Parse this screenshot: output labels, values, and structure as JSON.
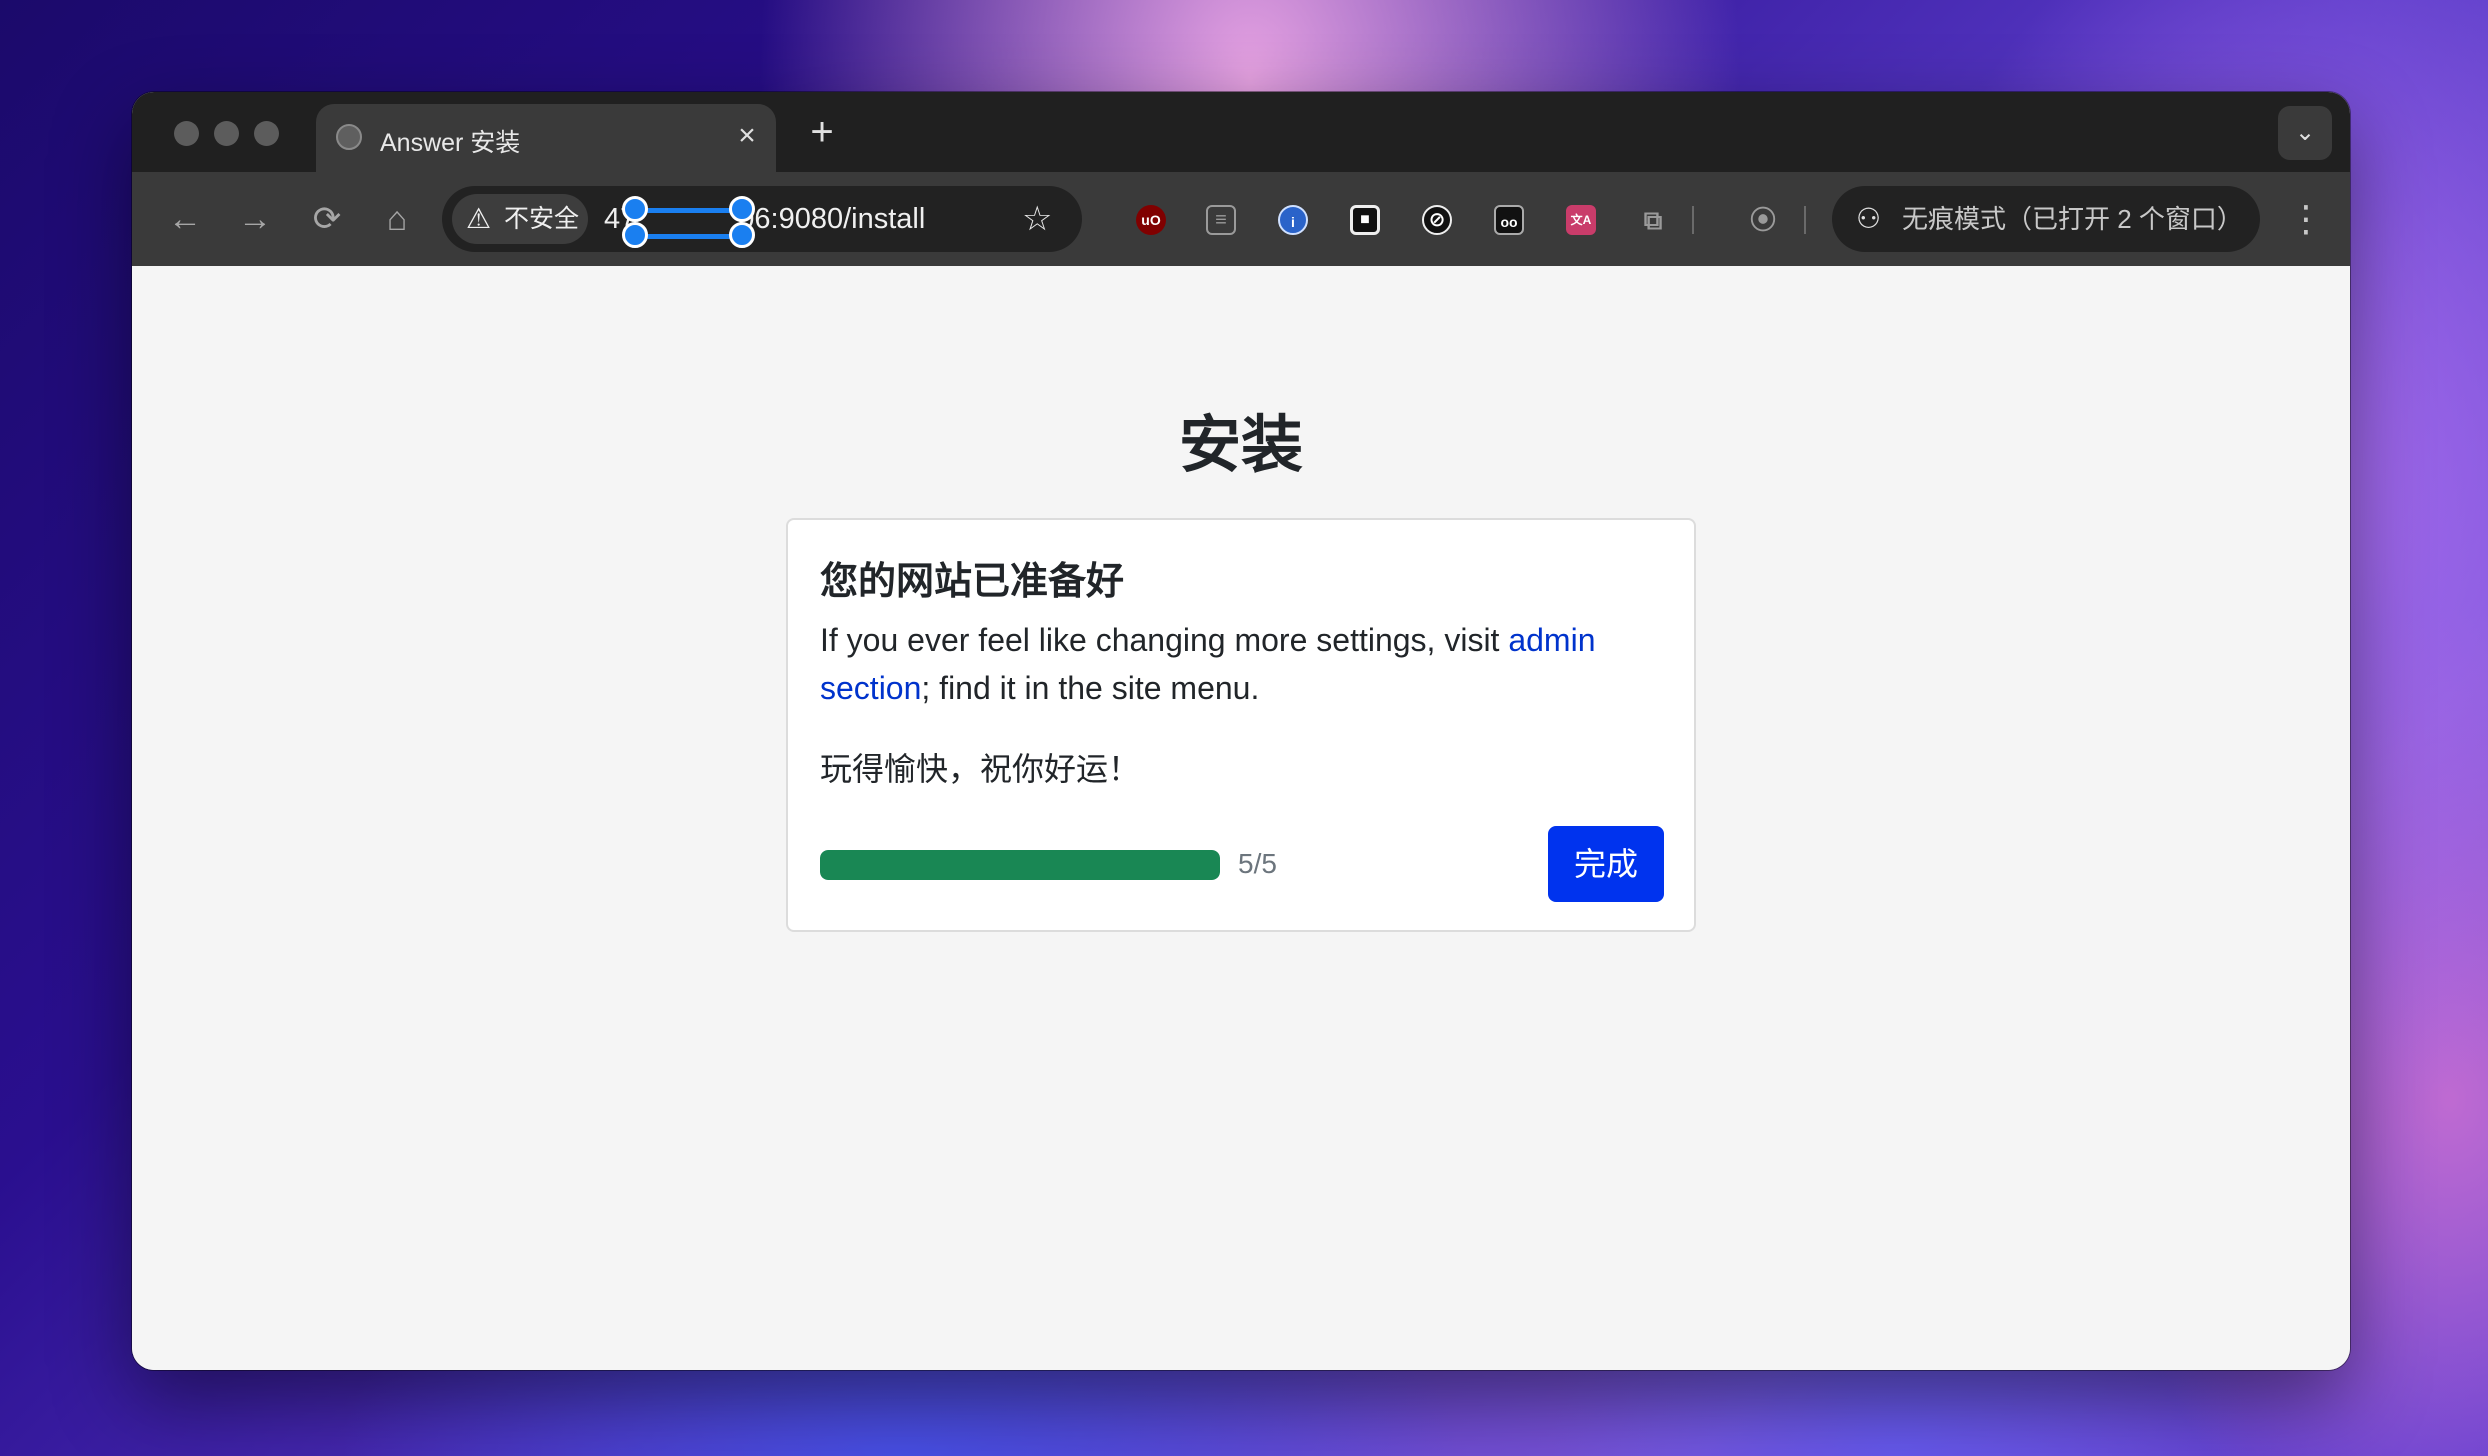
{
  "browser": {
    "tab": {
      "title": "Answer 安装",
      "close": "×"
    },
    "new_tab": "+",
    "tab_dropdown": "⌄",
    "nav": {
      "back": "←",
      "forward": "→",
      "reload": "⟳",
      "home": "⌂"
    },
    "security_chip": {
      "icon": "⚠",
      "label": "不安全"
    },
    "url": {
      "prefix": "47",
      "suffix": "06:9080/install"
    },
    "bookmark_star": "☆",
    "incognito": {
      "icon": "⚇",
      "label": "无痕模式（已打开 2 个窗口）"
    },
    "menu": "⋮",
    "extensions": [
      {
        "name": "ublock-origin-icon",
        "label": "uO",
        "color": "#800000"
      },
      {
        "name": "reader-icon",
        "label": "≡",
        "color": "transparent"
      },
      {
        "name": "password-manager-icon",
        "label": "i",
        "color": "#2a63c9"
      },
      {
        "name": "square-stop-icon",
        "label": "■",
        "color": "#111111"
      },
      {
        "name": "block-icon",
        "label": "⊘",
        "color": "#111111"
      },
      {
        "name": "glasses-icon",
        "label": "oo",
        "color": "#111111"
      },
      {
        "name": "translate-icon",
        "label": "文A",
        "color": "#c93c6a"
      },
      {
        "name": "extensions-puzzle-icon",
        "label": "⧉",
        "color": "transparent"
      },
      {
        "name": "screenshot-icon",
        "label": "⦿",
        "color": "transparent"
      }
    ]
  },
  "page": {
    "title": "安装",
    "card": {
      "heading": "您的网站已准备好",
      "text_before_link": "If you ever feel like changing more settings, visit ",
      "link_text": "admin section",
      "text_after_link": "; find it in the site menu.",
      "wish": "玩得愉快，祝你好运！",
      "progress": {
        "value": 1.0,
        "label": "5/5"
      },
      "done_button": "完成"
    }
  }
}
